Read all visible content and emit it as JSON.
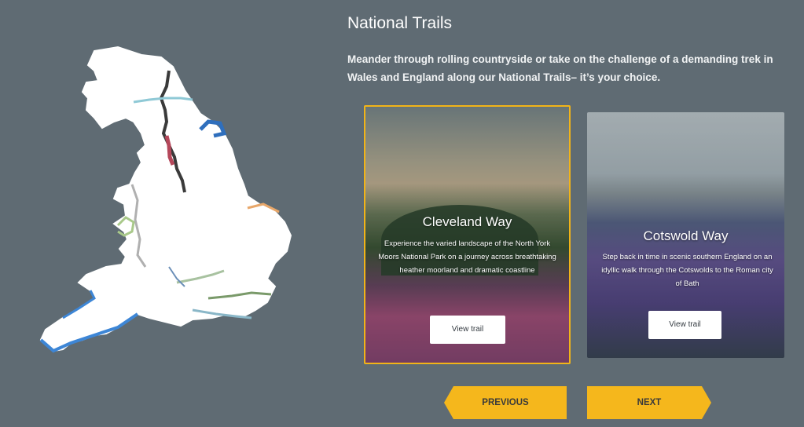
{
  "section": {
    "title": "National Trails",
    "intro": "Meander through rolling countryside or take on the challenge of a demanding trek in Wales and England along our National Trails– it’s your choice."
  },
  "cards": [
    {
      "title": "Cleveland Way",
      "description": "Experience the varied landscape of the North York Moors National Park on a journey across breathtaking heather moorland and dramatic coastline",
      "button": "View trail"
    },
    {
      "title": "Cotswold Way",
      "description": "Step back in time in scenic southern England on an idyllic walk through the Cotswolds to the Roman city of Bath",
      "button": "View trail"
    }
  ],
  "navigation": {
    "previous": "PREVIOUS",
    "next": "NEXT"
  },
  "colors": {
    "background": "#5f6b73",
    "accent": "#f5b71c"
  }
}
